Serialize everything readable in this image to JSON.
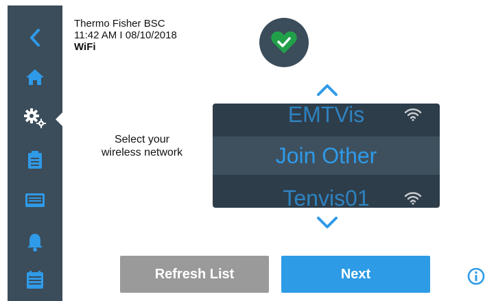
{
  "header": {
    "device_name": "Thermo Fisher BSC",
    "datetime": "11:42 AM I 08/10/2018",
    "page_title": "WiFi"
  },
  "status": {
    "icon": "heart-check-icon",
    "color": "#21a04a"
  },
  "sidebar": {
    "items": [
      {
        "icon": "back-chevron-icon"
      },
      {
        "icon": "home-icon"
      },
      {
        "icon": "settings-gears-icon",
        "active": true
      },
      {
        "icon": "clipboard-icon"
      },
      {
        "icon": "display-icon"
      },
      {
        "icon": "bell-icon"
      },
      {
        "icon": "calendar-list-icon"
      }
    ],
    "accent": "#2f9ae8"
  },
  "main": {
    "prompt": "Select your wireless network",
    "networks": [
      {
        "name": "EMTVis",
        "icon": "wifi-icon"
      },
      {
        "name": "Join Other",
        "selected": true
      },
      {
        "name": "Tenvis01",
        "icon": "wifi-icon"
      }
    ]
  },
  "buttons": {
    "refresh": "Refresh List",
    "next": "Next"
  },
  "colors": {
    "sidebar_bg": "#3b4c5a",
    "picker_bg": "#2e3d4a",
    "accent_blue": "#2e9be6",
    "button_grey": "#9a9a9a"
  }
}
